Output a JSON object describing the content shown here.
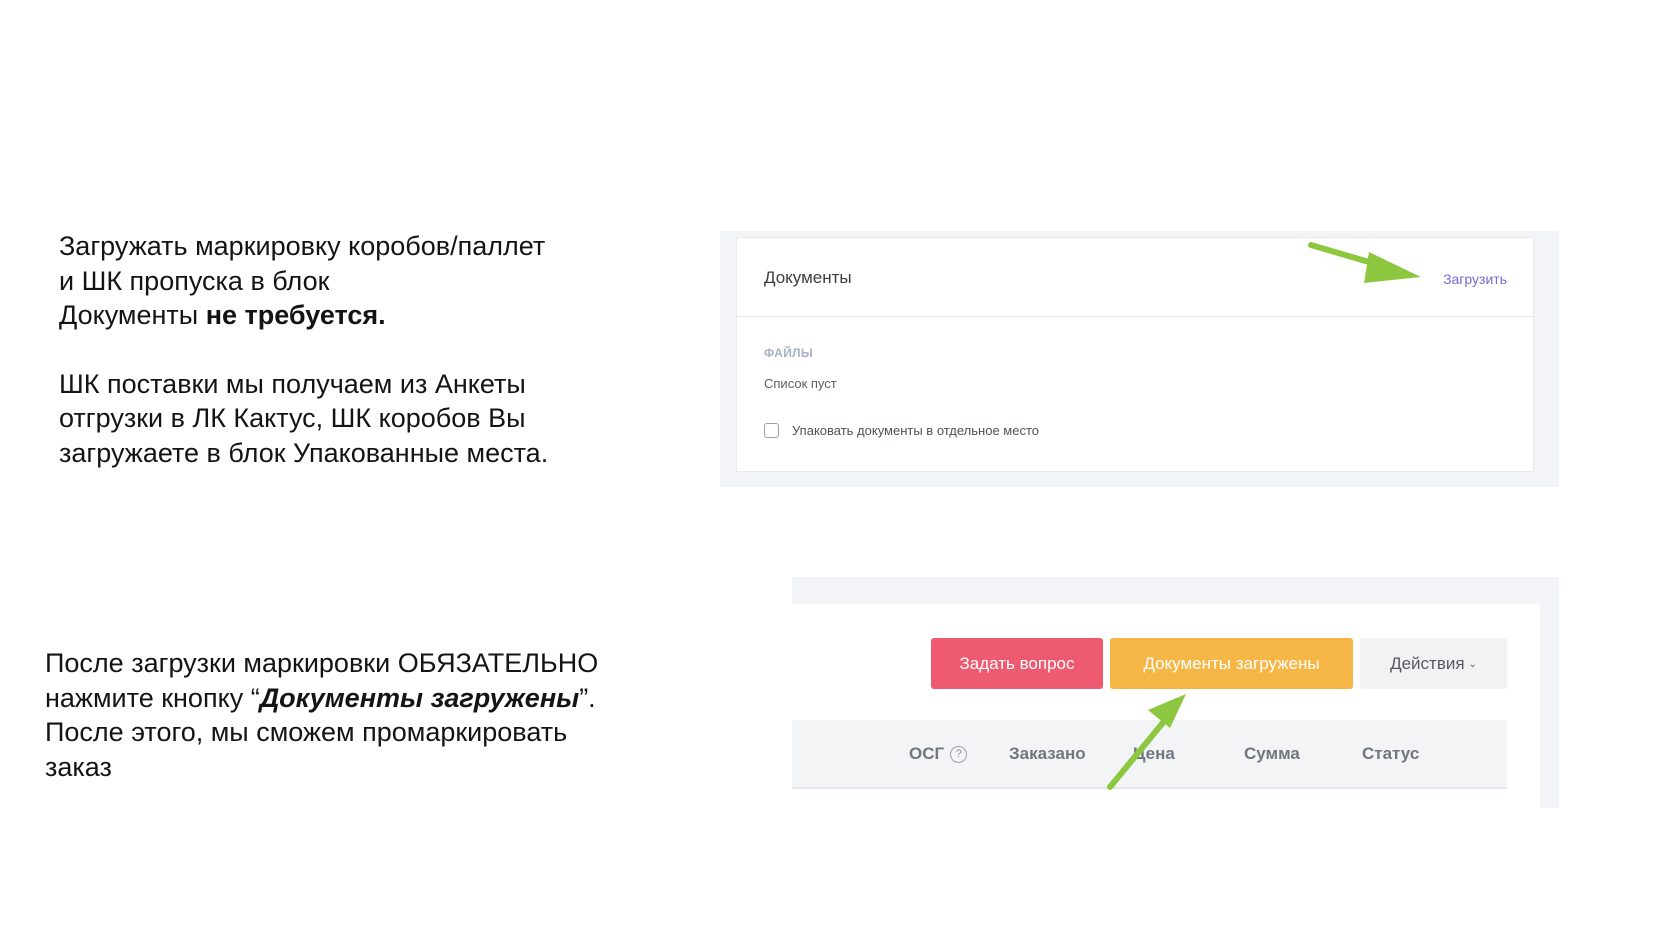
{
  "instructions": {
    "block1": {
      "line1": "Загружать маркировку коробов/паллет",
      "line2": "и ШК пропуска в блок",
      "line3_prefix": "Документы ",
      "line3_bold": "не требуется.",
      "para2_line1": "ШК поставки мы получаем из Анкеты",
      "para2_line2": "отгрузки в ЛК Кактус, ШК коробов Вы",
      "para2_line3": "загружаете в блок Упакованные места."
    },
    "block2": {
      "line1": "После загрузки маркировки  ОБЯЗАТЕЛЬНО",
      "line2_prefix": "нажмите кнопку “",
      "line2_bold_italic": "Документы загружены",
      "line2_suffix": "”.",
      "line3": "После этого, мы сможем промаркировать",
      "line4": "заказ"
    }
  },
  "documents_card": {
    "title": "Документы",
    "upload_link": "Загрузить",
    "files_label": "ФАЙЛЫ",
    "empty_text": "Список пуст",
    "pack_checkbox_label": "Упаковать документы в отдельное место",
    "pack_checkbox_checked": false
  },
  "actions_bar": {
    "ask_button": "Задать вопрос",
    "docs_uploaded_button": "Документы загружены",
    "actions_button": "Действия",
    "colors": {
      "ask": "#ee5a6f",
      "docs_uploaded": "#f6b645",
      "actions": "#f1f2f4"
    }
  },
  "table_header": {
    "osg": "ОСГ",
    "osg_help": "?",
    "ordered": "Заказано",
    "price": "Цена",
    "sum": "Сумма",
    "status": "Статус"
  },
  "annotation": {
    "arrow_color": "#8dc63f"
  }
}
